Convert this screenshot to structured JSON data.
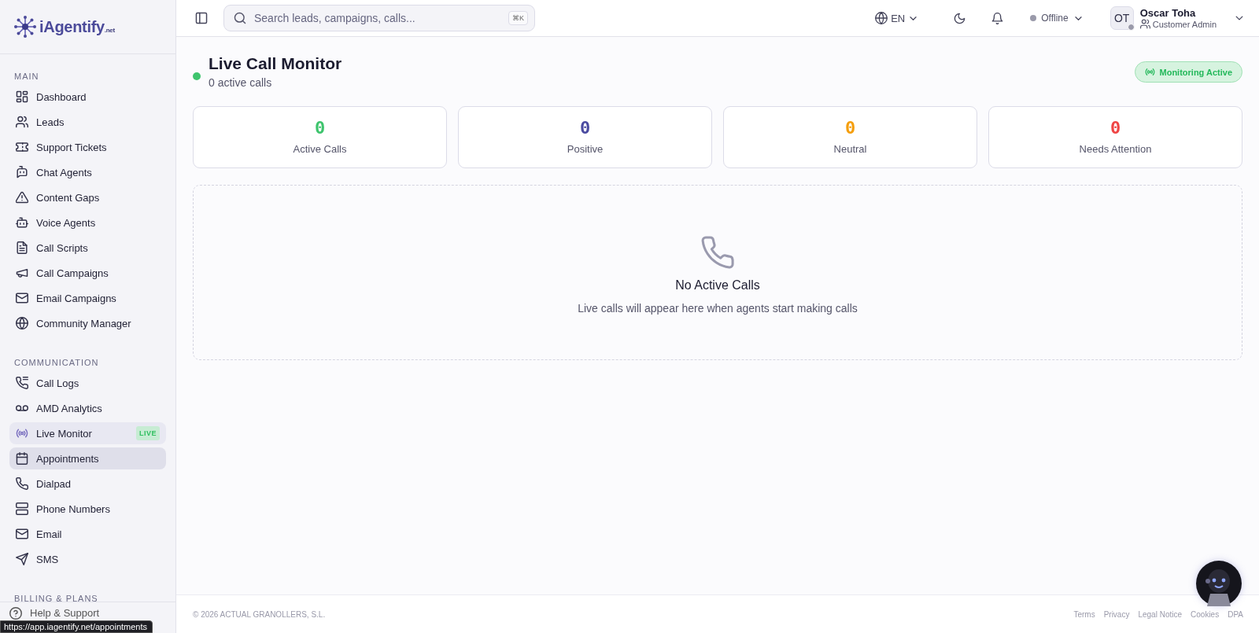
{
  "brand": {
    "name": "iAgentify",
    "suffix": ".net"
  },
  "sidebar": {
    "sections": [
      {
        "title": "MAIN",
        "items": [
          {
            "label": "Dashboard",
            "selected": false,
            "hovered": false
          },
          {
            "label": "Leads",
            "selected": false,
            "hovered": false
          },
          {
            "label": "Support Tickets",
            "selected": false,
            "hovered": false
          },
          {
            "label": "Chat Agents",
            "selected": false,
            "hovered": false
          },
          {
            "label": "Content Gaps",
            "selected": false,
            "hovered": false
          },
          {
            "label": "Voice Agents",
            "selected": false,
            "hovered": false
          },
          {
            "label": "Call Scripts",
            "selected": false,
            "hovered": false
          },
          {
            "label": "Call Campaigns",
            "selected": false,
            "hovered": false
          },
          {
            "label": "Email Campaigns",
            "selected": false,
            "hovered": false
          },
          {
            "label": "Community Manager",
            "selected": false,
            "hovered": false
          }
        ]
      },
      {
        "title": "COMMUNICATION",
        "items": [
          {
            "label": "Call Logs",
            "selected": false,
            "hovered": false
          },
          {
            "label": "AMD Analytics",
            "selected": false,
            "hovered": false
          },
          {
            "label": "Live Monitor",
            "selected": true,
            "hovered": false,
            "badge": "LIVE"
          },
          {
            "label": "Appointments",
            "selected": false,
            "hovered": true
          },
          {
            "label": "Dialpad",
            "selected": false,
            "hovered": false
          },
          {
            "label": "Phone Numbers",
            "selected": false,
            "hovered": false
          },
          {
            "label": "Email",
            "selected": false,
            "hovered": false
          },
          {
            "label": "SMS",
            "selected": false,
            "hovered": false
          }
        ]
      },
      {
        "title": "BILLING & PLANS"
      }
    ],
    "help": "Help & Support"
  },
  "link_preview": "https://app.iagentify.net/appointments",
  "header": {
    "search": {
      "placeholder": "Search leads, campaigns, calls...",
      "shortcut": "⌘K"
    },
    "language": "EN",
    "status": {
      "label": "Offline",
      "online": false
    },
    "user": {
      "initials": "OT",
      "name": "Oscar Toha",
      "role": "Customer Admin"
    }
  },
  "page": {
    "title": "Live Call Monitor",
    "subtitle": "0 active calls",
    "live": true,
    "monitoring": {
      "label": "Monitoring Active",
      "active": true
    },
    "stats": [
      {
        "value": "0",
        "label": "Active Calls",
        "color": "#3ec46d"
      },
      {
        "value": "0",
        "label": "Positive",
        "color": "#4a4aa0"
      },
      {
        "value": "0",
        "label": "Neutral",
        "color": "#f59e0b"
      },
      {
        "value": "0",
        "label": "Needs Attention",
        "color": "#ef4444"
      }
    ],
    "empty": {
      "title": "No Active Calls",
      "text": "Live calls will appear here when agents start making calls"
    }
  },
  "footer": {
    "copyright": "© 2026 ACTUAL GRANOLLERS, S.L.",
    "links": [
      "Terms",
      "Privacy",
      "Legal Notice",
      "Cookies",
      "DPA"
    ]
  }
}
